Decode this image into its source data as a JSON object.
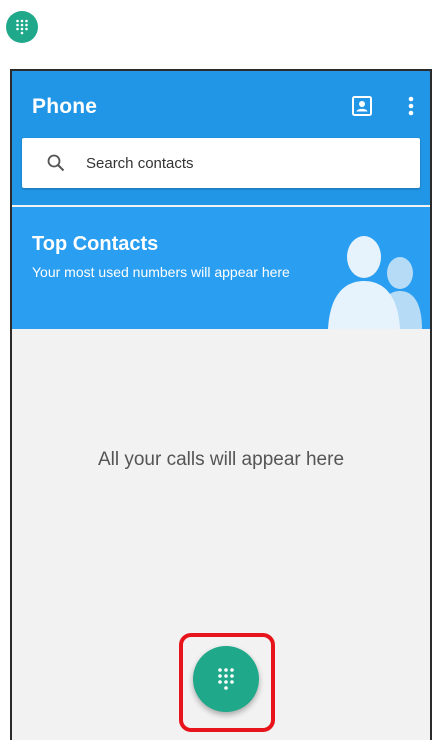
{
  "app_shortcut": {
    "icon": "dialpad-icon",
    "color": "#1fa88a"
  },
  "appbar": {
    "title": "Phone",
    "contacts_icon": "contacts-icon",
    "overflow_icon": "more-vert-icon",
    "color": "#2196e6"
  },
  "search": {
    "placeholder": "Search contacts",
    "icon": "search-icon"
  },
  "top_contacts": {
    "title": "Top Contacts",
    "subtitle": "Your most used numbers will appear here",
    "art": "people-silhouette-icon",
    "color": "#2a9ef0"
  },
  "calls": {
    "empty_message": "All your calls will appear here"
  },
  "fab": {
    "icon": "dialpad-icon",
    "color": "#1fa88a",
    "highlight_color": "#e8141b"
  }
}
